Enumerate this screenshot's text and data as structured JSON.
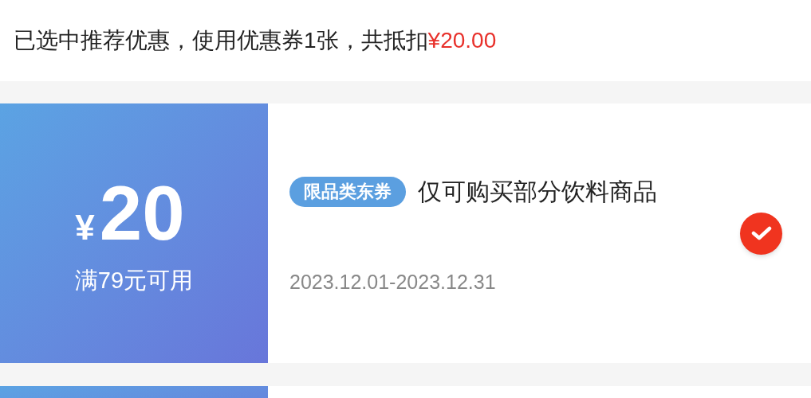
{
  "summary": {
    "text": "已选中推荐优惠，使用优惠券1张，共抵扣",
    "amount": "¥20.00"
  },
  "coupons": [
    {
      "currency": "¥",
      "value": "20",
      "condition": "满79元可用",
      "tag": "限品类东券",
      "title": "仅可购买部分饮料商品",
      "validity": "2023.12.01-2023.12.31",
      "selected": true
    }
  ]
}
